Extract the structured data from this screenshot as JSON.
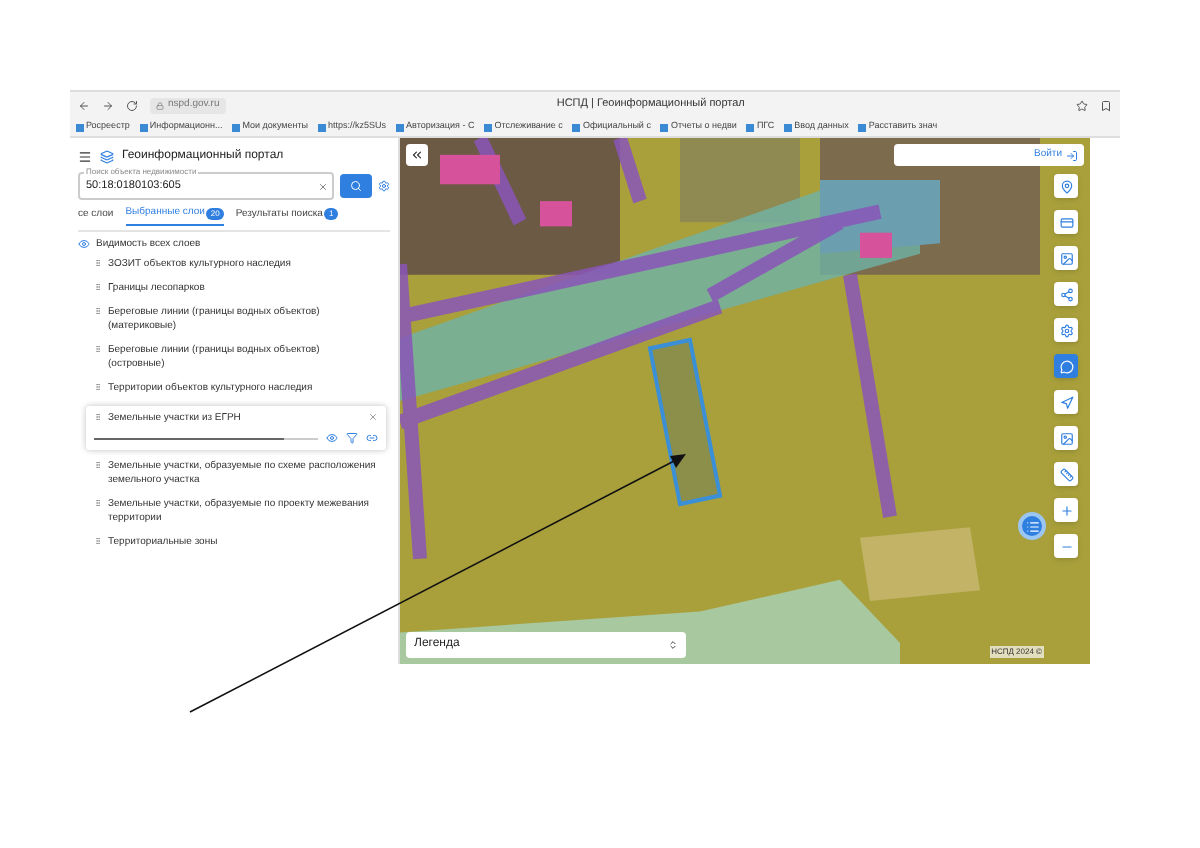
{
  "browser": {
    "address": "nspd.gov.ru",
    "tab_title": "НСПД | Геоинформационный портал",
    "bookmarks": [
      "Росреестр",
      "Информационн...",
      "Мои документы",
      "https://kz5SUs",
      "Авторизация - С",
      "Отслеживание с",
      "Официальный с",
      "Отчеты о недви",
      "ПГС",
      "Ввод данных",
      "Расставить знач"
    ]
  },
  "sidebar": {
    "title": "Геоинформационный портал",
    "search": {
      "placeholder": "Поиск объекта недвижимости",
      "value": "50:18:0180103:605"
    },
    "tabs": [
      {
        "label": "се слои",
        "selected": false
      },
      {
        "label": "Выбранные слои",
        "badge": "20",
        "selected": true
      },
      {
        "label": "Результаты поиска",
        "badge": "1",
        "selected": false
      }
    ],
    "visibility_label": "Видимость всех слоев",
    "layers": [
      {
        "name": "ЗОЗИТ объектов культурного наследия",
        "expanded": false
      },
      {
        "name": "Границы лесопарков",
        "expanded": false
      },
      {
        "name": "Береговые линии (границы водных объектов) (материковые)",
        "expanded": false
      },
      {
        "name": "Береговые линии (границы водных объектов) (островные)",
        "expanded": false
      },
      {
        "name": "Территории объектов культурного наследия",
        "expanded": false
      },
      {
        "name": "Земельные участки из ЕГРН",
        "expanded": true,
        "level": 0.85
      },
      {
        "name": "Земельные участки, образуемые по схеме расположения земельного участка",
        "expanded": false
      },
      {
        "name": "Земельные участки, образуемые по проекту межевания территории",
        "expanded": false
      },
      {
        "name": "Территориальные зоны",
        "expanded": false
      }
    ]
  },
  "map": {
    "login": "Войти",
    "legend": "Легенда",
    "attribution": "НСПД 2024 ©"
  }
}
